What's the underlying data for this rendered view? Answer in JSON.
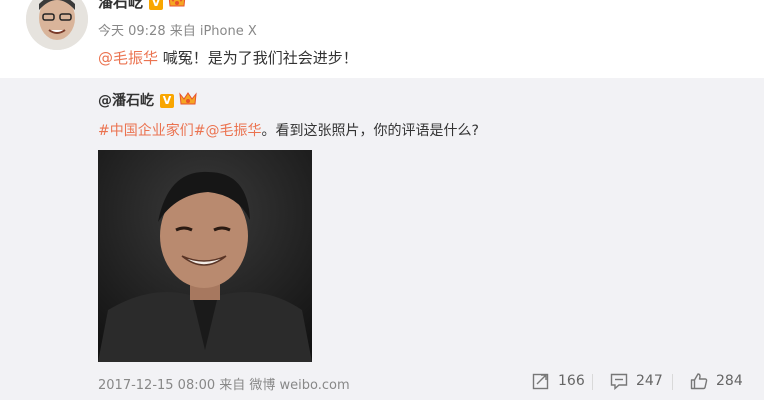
{
  "post": {
    "author": "潘石屹",
    "meta": "今天 09:28 来自 iPhone X",
    "content": {
      "mention": "@毛振华",
      "text": " 喊冤！是为了我们社会进步！"
    }
  },
  "retweet": {
    "author": "@潘石屹",
    "hashtag": "#中国企业家们#",
    "mention": "@毛振华",
    "text": "。看到这张照片，你的评语是什么?",
    "meta": "2017-12-15 08:00 来自 微博 weibo.com",
    "stats": {
      "forwards": "166",
      "comments": "247",
      "likes": "284"
    }
  },
  "colors": {
    "link": "#eb7350",
    "verified_badge": "#f9a600",
    "retweet_bg": "#f2f2f5"
  },
  "icons": {
    "forward": "forward-icon",
    "comment": "comment-icon",
    "like": "like-icon"
  }
}
